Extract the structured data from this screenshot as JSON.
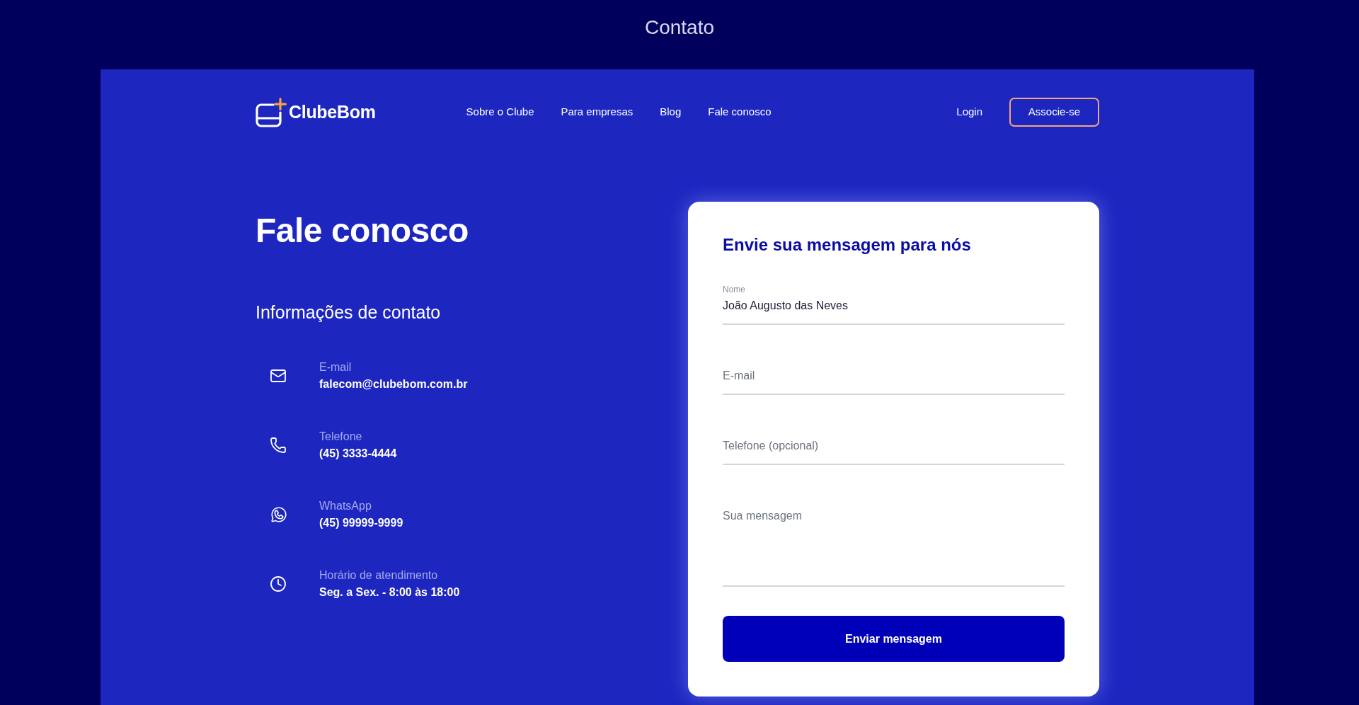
{
  "page_title": "Contato",
  "header": {
    "logo": {
      "text": "ClubeBom"
    },
    "nav": [
      "Sobre o Clube",
      "Para empresas",
      "Blog",
      "Fale conosco"
    ],
    "login": "Login",
    "cta": "Associe-se"
  },
  "info": {
    "title": "Fale conosco",
    "subtitle": "Informações de contato",
    "contacts": [
      {
        "kind": "email",
        "label": "E-mail",
        "value": "falecom@clubebom.com.br"
      },
      {
        "kind": "phone",
        "label": "Telefone",
        "value": "(45) 3333-4444"
      },
      {
        "kind": "whatsapp",
        "label": "WhatsApp",
        "value": "(45) 99999-9999"
      },
      {
        "kind": "hours",
        "label": "Horário de atendimento",
        "value": "Seg. a Sex. - 8:00 às 18:00"
      }
    ]
  },
  "form": {
    "title": "Envie sua mensagem para nós",
    "fields": [
      {
        "kind": "text",
        "label": "Nome",
        "value": "João Augusto das Neves"
      },
      {
        "kind": "text",
        "placeholder": "E-mail"
      },
      {
        "kind": "text",
        "placeholder": "Telefone (opcional)"
      },
      {
        "kind": "textarea",
        "placeholder": "Sua mensagem"
      }
    ],
    "submit": "Enviar mensagem"
  }
}
